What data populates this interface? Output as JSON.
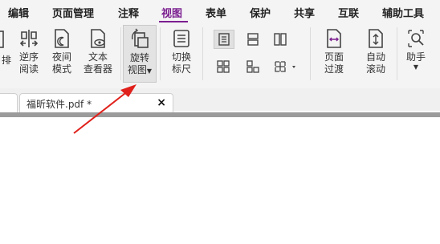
{
  "menu": {
    "items": [
      "编辑",
      "页面管理",
      "注释",
      "视图",
      "表单",
      "保护",
      "共享",
      "互联",
      "辅助工具"
    ],
    "active": "视图"
  },
  "ribbon": {
    "paging_partial": "排",
    "reverse_reading": [
      "逆序",
      "阅读"
    ],
    "night_mode": [
      "夜间",
      "模式"
    ],
    "text_viewer": [
      "文本",
      "查看器"
    ],
    "rotate_view": [
      "旋转",
      "视图"
    ],
    "toggle_ruler": [
      "切换",
      "标尺"
    ],
    "page_transition": [
      "页面",
      "过渡"
    ],
    "auto_scroll": [
      "自动",
      "滚动"
    ],
    "assistant": "助手"
  },
  "tabs": {
    "document_title": "福昕软件.pdf *",
    "close_symbol": "×"
  },
  "colors": {
    "accent": "#7b1f8f",
    "annotation_arrow": "#e0201b"
  }
}
